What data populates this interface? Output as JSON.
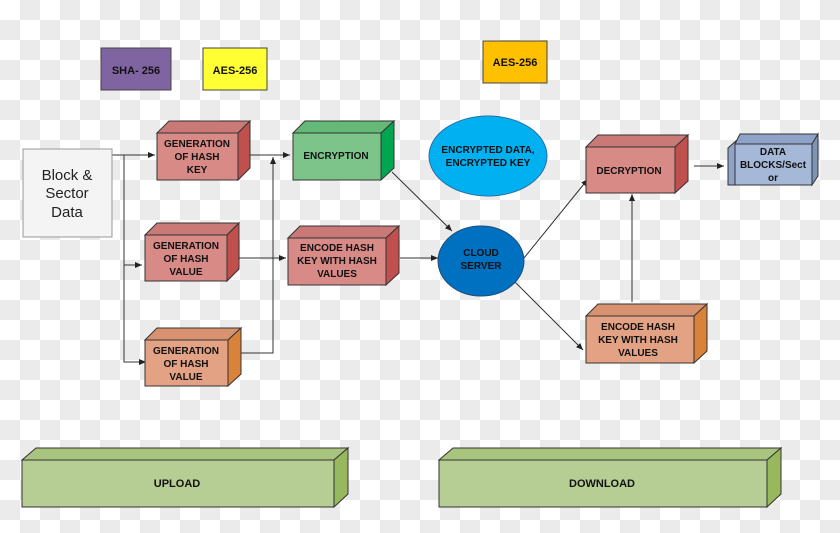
{
  "legend": {
    "sha": "SHA- 256",
    "aes_upload": "AES-256",
    "aes_download": "AES-256"
  },
  "nodes": {
    "block_sector": [
      "Block &",
      "Sector",
      "Data"
    ],
    "gen_hash_key": [
      "GENERATION",
      "OF HASH",
      "KEY"
    ],
    "gen_hash_value_1": [
      "GENERATION",
      "OF HASH",
      "VALUE"
    ],
    "gen_hash_value_2": [
      "GENERATION",
      "OF HASH",
      "VALUE"
    ],
    "encryption": [
      "ENCRYPTION"
    ],
    "encode_upload": [
      "ENCODE HASH",
      "KEY WITH HASH",
      "VALUES"
    ],
    "encrypted_data": [
      "ENCRYPTED DATA,",
      "ENCRYPTED KEY"
    ],
    "cloud_server": [
      "CLOUD",
      "SERVER"
    ],
    "decryption": [
      "DECRYPTION"
    ],
    "encode_download": [
      "ENCODE HASH",
      "KEY WITH HASH",
      "VALUES"
    ],
    "data_blocks": [
      "DATA",
      "BLOCKS/Sect",
      "or"
    ]
  },
  "phases": {
    "upload": "UPLOAD",
    "download": "DOWNLOAD"
  },
  "colors": {
    "sha": "#8064a2",
    "aes_upload": "#ffff33",
    "aes_download": "#ffc000",
    "red_box": "#d88a87",
    "red_side": "#c0504d",
    "orange_box": "#e3a283",
    "orange_side": "#d8823a",
    "green_box": "#7cc48a",
    "green_side": "#00a550",
    "light_blue": "#00b0f0",
    "dark_blue": "#0070c0",
    "blue_box": "#a6b8d8",
    "phase": "#b6cd93",
    "phase_side": "#98b85d"
  }
}
